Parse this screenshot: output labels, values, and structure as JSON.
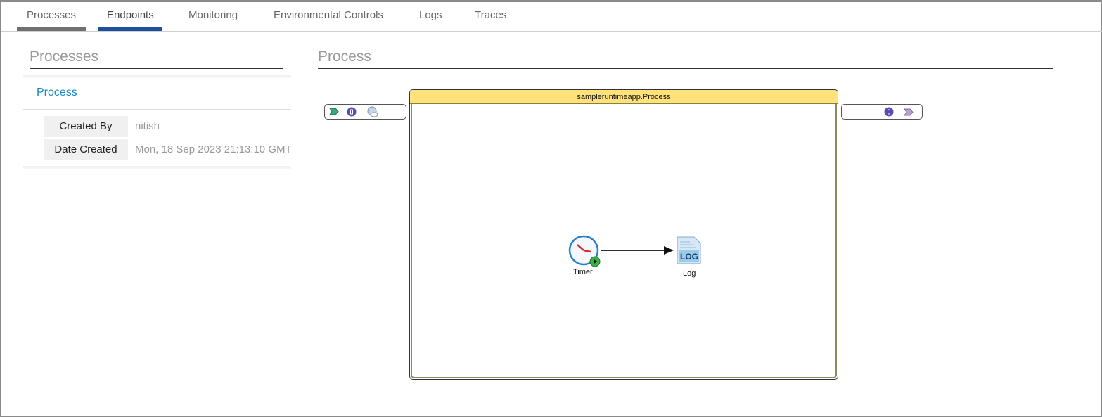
{
  "tabs": [
    {
      "label": "Processes"
    },
    {
      "label": "Endpoints"
    },
    {
      "label": "Monitoring"
    },
    {
      "label": "Environmental Controls"
    },
    {
      "label": "Logs"
    },
    {
      "label": "Traces"
    }
  ],
  "left": {
    "title": "Processes",
    "item": "Process",
    "details": [
      {
        "label": "Created By",
        "value": "nitish"
      },
      {
        "label": "Date Created",
        "value": "Mon, 18 Sep 2023 21:13:10 GMT"
      }
    ]
  },
  "right": {
    "title": "Process",
    "diagram": {
      "process_name": "sampleruntimeapp.Process",
      "nodes": [
        {
          "label": "Timer"
        },
        {
          "label": "Log",
          "icon_text": "LOG"
        }
      ]
    }
  },
  "colors": {
    "active_tab": "#1d4f9c",
    "link": "#1a8ac6",
    "header": "#ffe27a"
  }
}
